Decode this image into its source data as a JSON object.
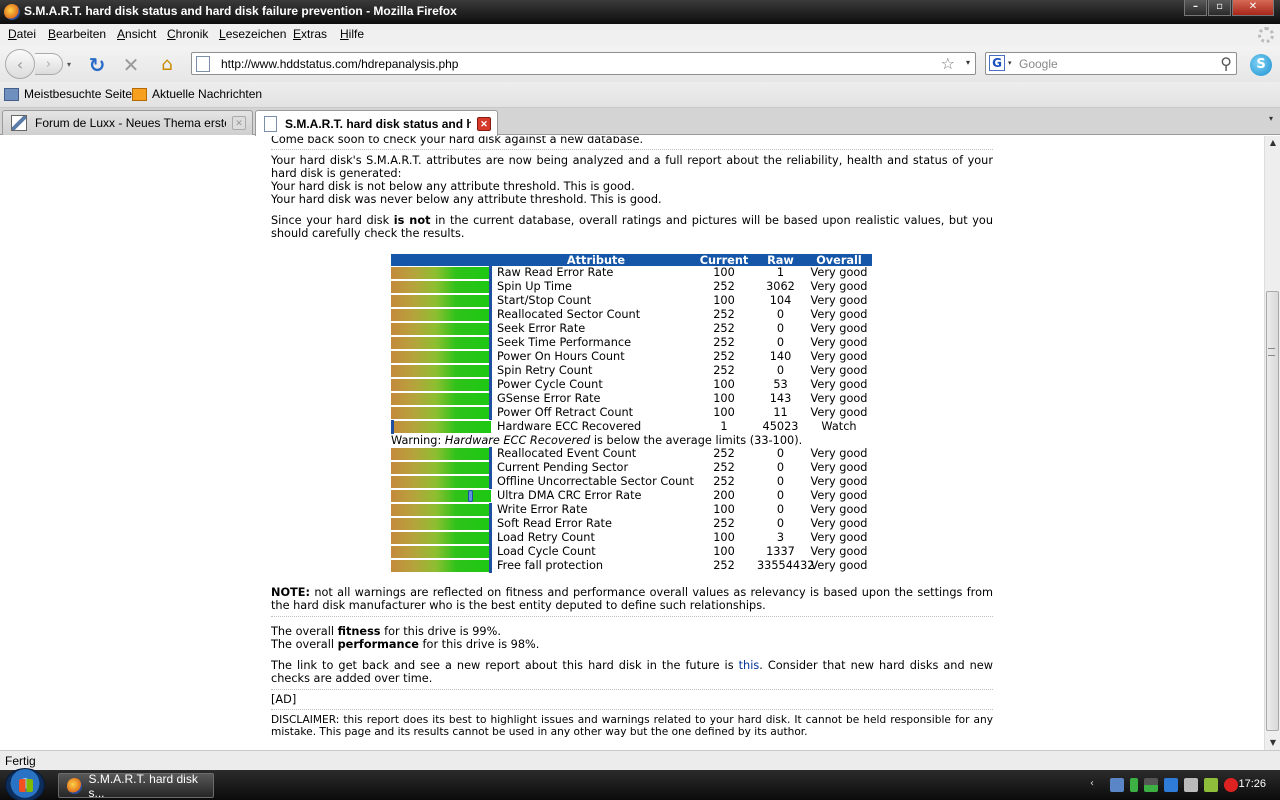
{
  "window": {
    "title": "S.M.A.R.T. hard disk status and hard disk failure prevention - Mozilla Firefox",
    "minimize": "–",
    "maximize": "▫",
    "close": "✕"
  },
  "menu": [
    "Datei",
    "Bearbeiten",
    "Ansicht",
    "Chronik",
    "Lesezeichen",
    "Extras",
    "Hilfe"
  ],
  "nav": {
    "back": "‹",
    "forward": "›",
    "history": "▾",
    "reload": "↻",
    "stop": "✕",
    "home": "⌂",
    "url": "http://www.hddstatus.com/hdrepanalysis.php",
    "bookmark_star": "☆",
    "url_dropdown": "▾",
    "search_engine": "G",
    "search_engine_drop": "▾",
    "search_placeholder": "Google",
    "search_go": "⚲",
    "addon": "S"
  },
  "bookmarks": [
    "Meistbesuchte Seiten",
    "Aktuelle Nachrichten"
  ],
  "tabs": [
    {
      "label": "Forum de Luxx - Neues Thema erstellen",
      "close": "✕",
      "active": false
    },
    {
      "label": "S.M.A.R.T. hard disk status and h...",
      "close": "✕",
      "active": true
    }
  ],
  "tab_list": "▾",
  "page": {
    "intro_top": "Come back soon to check your hard disk against a new database.",
    "analysis_1": "Your hard disk's S.M.A.R.T. attributes are now being analyzed and a full report about the reliability, health and status of your hard disk is generated:",
    "analysis_2": "Your hard disk is not below any attribute threshold. This is good.",
    "analysis_3": "Your hard disk was never below any attribute threshold. This is good.",
    "database_pre": "Since your hard disk ",
    "database_bold": "is not",
    "database_post": " in the current database, overall ratings and pictures will be based upon realistic values, but you should carefully check the results.",
    "table": {
      "headers": {
        "attribute": "Attribute",
        "current": "Current",
        "raw": "Raw",
        "overall": "Overall"
      },
      "rows_a": [
        {
          "attribute": "Raw Read Error Rate",
          "current": "100",
          "raw": "1",
          "overall": "Very good",
          "level": 1.0
        },
        {
          "attribute": "Spin Up Time",
          "current": "252",
          "raw": "3062",
          "overall": "Very good",
          "level": 1.0
        },
        {
          "attribute": "Start/Stop Count",
          "current": "100",
          "raw": "104",
          "overall": "Very good",
          "level": 1.0
        },
        {
          "attribute": "Reallocated Sector Count",
          "current": "252",
          "raw": "0",
          "overall": "Very good",
          "level": 1.0
        },
        {
          "attribute": "Seek Error Rate",
          "current": "252",
          "raw": "0",
          "overall": "Very good",
          "level": 1.0
        },
        {
          "attribute": "Seek Time Performance",
          "current": "252",
          "raw": "0",
          "overall": "Very good",
          "level": 1.0
        },
        {
          "attribute": "Power On Hours Count",
          "current": "252",
          "raw": "140",
          "overall": "Very good",
          "level": 1.0
        },
        {
          "attribute": "Spin Retry Count",
          "current": "252",
          "raw": "0",
          "overall": "Very good",
          "level": 1.0
        },
        {
          "attribute": "Power Cycle Count",
          "current": "100",
          "raw": "53",
          "overall": "Very good",
          "level": 1.0
        },
        {
          "attribute": "GSense Error Rate",
          "current": "100",
          "raw": "143",
          "overall": "Very good",
          "level": 1.0
        },
        {
          "attribute": "Power Off Retract Count",
          "current": "100",
          "raw": "11",
          "overall": "Very good",
          "level": 1.0
        },
        {
          "attribute": "Hardware ECC Recovered",
          "current": "1",
          "raw": "45023",
          "overall": "Watch",
          "level": 0.0
        }
      ],
      "warning_pre": "Warning: ",
      "warning_em": "Hardware ECC Recovered",
      "warning_post": " is below the average limits (33-100).",
      "rows_b": [
        {
          "attribute": "Reallocated Event Count",
          "current": "252",
          "raw": "0",
          "overall": "Very good",
          "level": 1.0
        },
        {
          "attribute": "Current Pending Sector",
          "current": "252",
          "raw": "0",
          "overall": "Very good",
          "level": 1.0
        },
        {
          "attribute": "Offline Uncorrectable Sector Count",
          "current": "252",
          "raw": "0",
          "overall": "Very good",
          "level": 1.0
        },
        {
          "attribute": "Ultra DMA CRC Error Rate",
          "current": "200",
          "raw": "0",
          "overall": "Very good",
          "level": 0.8
        },
        {
          "attribute": "Write Error Rate",
          "current": "100",
          "raw": "0",
          "overall": "Very good",
          "level": 1.0
        },
        {
          "attribute": "Soft Read Error Rate",
          "current": "252",
          "raw": "0",
          "overall": "Very good",
          "level": 1.0
        },
        {
          "attribute": "Load Retry Count",
          "current": "100",
          "raw": "3",
          "overall": "Very good",
          "level": 1.0
        },
        {
          "attribute": "Load Cycle Count",
          "current": "100",
          "raw": "1337",
          "overall": "Very good",
          "level": 1.0
        },
        {
          "attribute": "Free fall protection",
          "current": "252",
          "raw": "33554432",
          "overall": "Very good",
          "level": 1.0
        }
      ]
    },
    "note_bold": "NOTE:",
    "note_text": " not all warnings are reflected on fitness and performance overall values as relevancy is based upon the settings from the hard disk manufacturer who is the best entity deputed to define such relationships.",
    "fitness_pre": "The overall ",
    "fitness_bold": "fitness",
    "fitness_post": " for this drive is 99%.",
    "performance_pre": "The overall ",
    "performance_bold": "performance",
    "performance_post": " for this drive is 98%.",
    "link_pre": "The link to get back and see a new report about this hard disk in the future is ",
    "link_text": "this",
    "link_post": ". Consider that new hard disks and new checks are added over time.",
    "ad": "[AD]",
    "disclaimer": "DISCLAIMER: this report does its best to highlight issues and warnings related to your hard disk. It cannot be held responsible for any mistake. This page and its results cannot be used in any other way but the one defined by its author."
  },
  "status": "Fertig",
  "taskbar": {
    "task_label": "S.M.A.R.T. hard disk s...",
    "clock": "17:26"
  },
  "scroll": {
    "up": "▲",
    "down": "▼"
  }
}
